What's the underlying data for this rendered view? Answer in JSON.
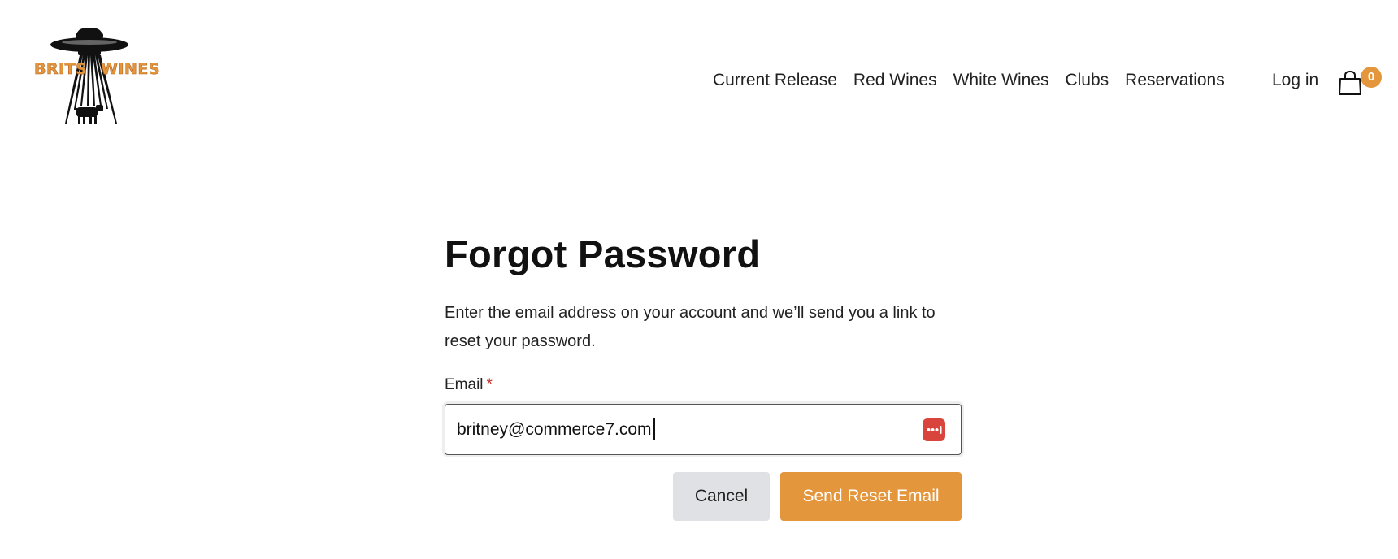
{
  "brand": {
    "logo_word_left": "BRITS",
    "logo_word_right": "WINES",
    "accent_color": "#e3963c"
  },
  "nav": {
    "items": [
      "Current Release",
      "Red Wines",
      "White Wines",
      "Clubs",
      "Reservations"
    ]
  },
  "account": {
    "login_label": "Log in",
    "cart_count": "0",
    "cart_icon": "shopping-bag-icon"
  },
  "form": {
    "title": "Forgot Password",
    "description": "Enter the email address on your account and we’ll send you a link to reset your password.",
    "email_label": "Email",
    "required_mark": "*",
    "email_value": "britney@commerce7.com",
    "password_manager_icon": "password-manager-icon",
    "cancel_label": "Cancel",
    "submit_label": "Send Reset Email",
    "required_color": "#c8302c"
  }
}
